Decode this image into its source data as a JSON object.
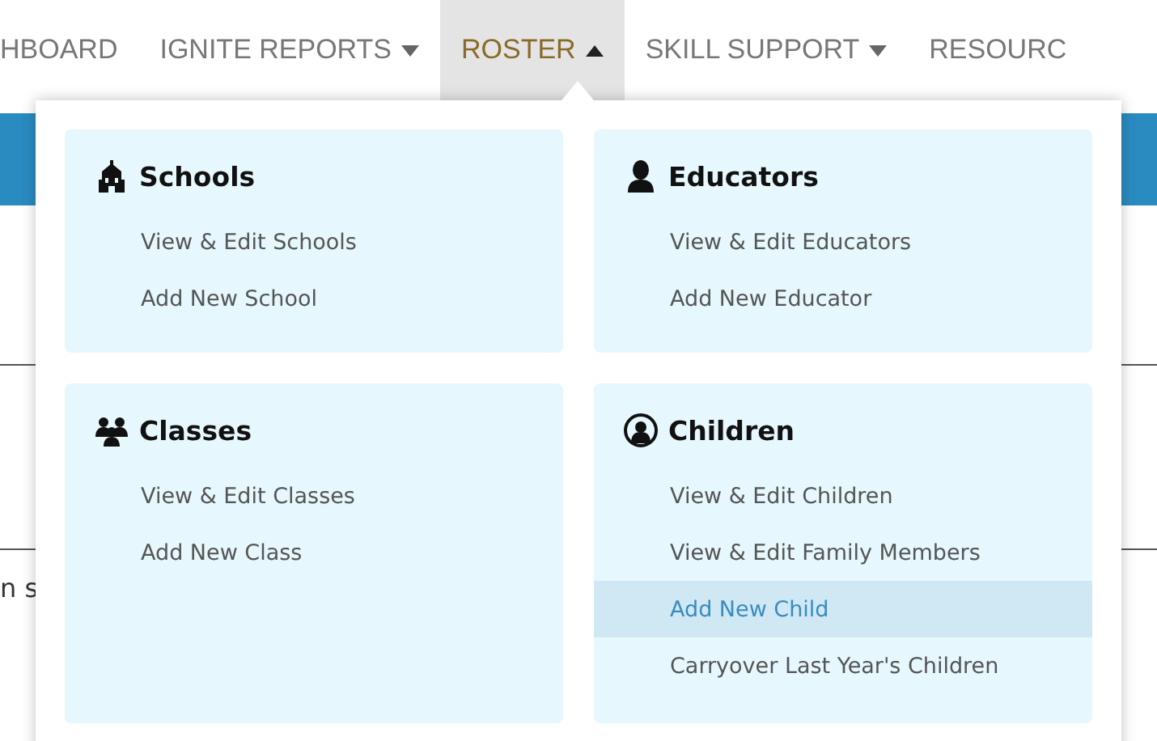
{
  "nav": [
    {
      "label": "HBOARD",
      "kind": "link",
      "selected": false
    },
    {
      "label": "IGNITE REPORTS",
      "kind": "menu",
      "expanded": false,
      "selected": false
    },
    {
      "label": "ROSTER",
      "kind": "menu",
      "expanded": true,
      "selected": true
    },
    {
      "label": "SKILL SUPPORT",
      "kind": "menu",
      "expanded": false,
      "selected": false
    },
    {
      "label": "RESOURC",
      "kind": "link",
      "selected": false
    }
  ],
  "page": {
    "text": "n s"
  },
  "dropdown": {
    "sections": [
      {
        "title": "Schools",
        "kind": "school",
        "items": [
          {
            "label": "View & Edit Schools",
            "selected": false
          },
          {
            "label": "Add New School",
            "selected": false
          }
        ]
      },
      {
        "title": "Educators",
        "kind": "person",
        "items": [
          {
            "label": "View & Edit Educators",
            "selected": false
          },
          {
            "label": "Add New Educator",
            "selected": false
          }
        ]
      },
      {
        "title": "Classes",
        "kind": "group",
        "items": [
          {
            "label": "View & Edit Classes",
            "selected": false
          },
          {
            "label": "Add New Class",
            "selected": false
          }
        ]
      },
      {
        "title": "Children",
        "kind": "child",
        "items": [
          {
            "label": "View & Edit Children",
            "selected": false
          },
          {
            "label": "View & Edit Family Members",
            "selected": false
          },
          {
            "label": "Add New Child",
            "selected": true
          },
          {
            "label": "Carryover Last Year's Children",
            "selected": false
          }
        ]
      }
    ]
  }
}
